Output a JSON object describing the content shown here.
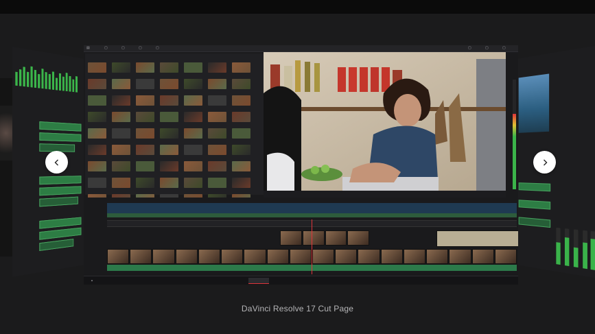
{
  "caption": "DaVinci Resolve 17 Cut Page",
  "carousel": {
    "prev_icon": "chevron-left-icon",
    "next_icon": "chevron-right-icon"
  },
  "colors": {
    "page_background": "#1b1b1c",
    "accent_green": "#3bb54a",
    "playhead_red": "#e0343a",
    "nav_button": "#ffffff",
    "caption_text": "#b6b6b8"
  }
}
